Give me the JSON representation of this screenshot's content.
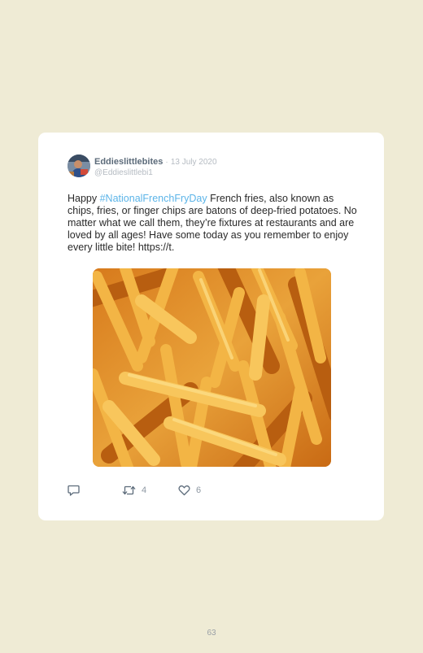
{
  "tweet": {
    "display_name": "Eddieslittlebites",
    "separator": "·",
    "date": "13 July 2020",
    "handle": "@Eddieslittlebi1",
    "text_before": "Happy ",
    "hashtag": "#NationalFrenchFryDay",
    "text_after": " French fries, also known as chips, fries, or finger chips are batons of deep-fried potatoes. No matter what we call them, they’re fixtures at restaurants and are loved by all ages! Have some today as you remember to enjoy every little bite! https://t.",
    "hashtag_color": "#5bb4e8"
  },
  "actions": {
    "reply_icon": "reply-icon",
    "retweet_icon": "retweet-icon",
    "retweet_count": "4",
    "like_icon": "heart-icon",
    "like_count": "6"
  },
  "page": {
    "number": "63",
    "background": "#efebd5"
  }
}
